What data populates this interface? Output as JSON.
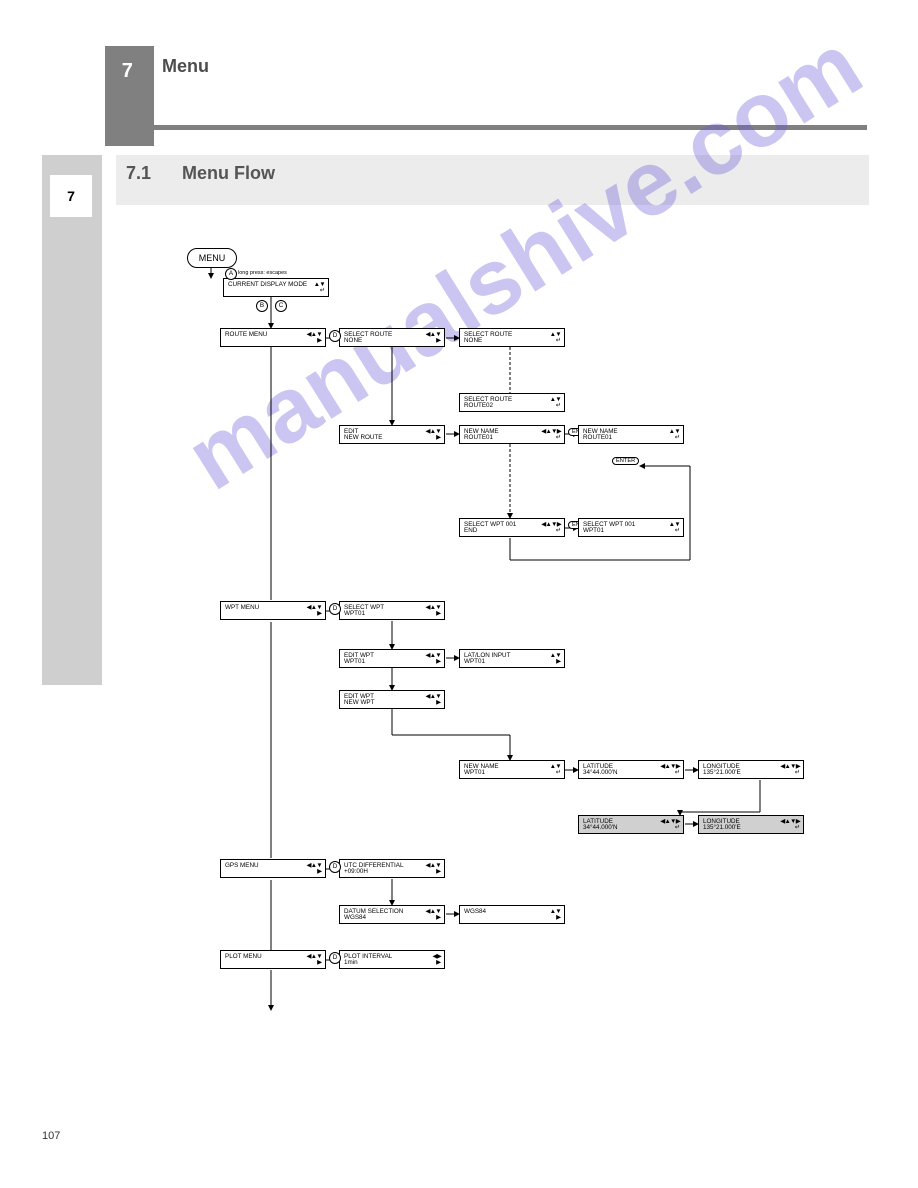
{
  "chapter_tab": "7",
  "chapter_title": "Menu",
  "side_num": "7",
  "section_num": "7.1",
  "section_title": "Menu Flow",
  "page_number": "107",
  "watermark": "manualshive.com",
  "menu_btn": "MENU",
  "tips": {
    "esc": "long press: escapes",
    "esc_short": "escapes"
  },
  "box": {
    "b1": {
      "l1": "CURRENT DISPLAY MODE",
      "l2": ""
    },
    "b2": {
      "l1": "ROUTE MENU",
      "l2": ""
    },
    "b3": {
      "l1": "SELECT ROUTE",
      "l2": "NONE"
    },
    "b4": {
      "l1": "SELECT ROUTE",
      "l2": "NONE"
    },
    "b4b": {
      "l1": "SELECT ROUTE",
      "l2": "ROUTE02"
    },
    "b5": {
      "l1": "EDIT",
      "l2": "NEW ROUTE"
    },
    "b6": {
      "l1": "NEW NAME",
      "l2": "ROUTE01"
    },
    "b7": {
      "l1": "NEW NAME",
      "l2": "ROUTE01"
    },
    "b8": {
      "l1": "SELECT WPT 001",
      "l2": "END"
    },
    "b9": {
      "l1": "SELECT WPT 001",
      "l2": "WPT01"
    },
    "b10": {
      "l1": "WPT MENU",
      "l2": ""
    },
    "b11": {
      "l1": "SELECT WPT",
      "l2": "WPT01"
    },
    "b12": {
      "l1": "EDIT WPT",
      "l2": "WPT01"
    },
    "b13": {
      "l1": "LAT/LON INPUT",
      "l2": "WPT01"
    },
    "b14": {
      "l1": "EDIT WPT",
      "l2": "NEW WPT"
    },
    "b15": {
      "l1": "NEW NAME",
      "l2": "WPT01"
    },
    "b16": {
      "l1": "LATITUDE",
      "l2": "34°44.000'N"
    },
    "b17": {
      "l1": "LONGITUDE",
      "l2": "135°21.000'E"
    },
    "b18": {
      "l1": "LATITUDE",
      "l2": "34°44.000'N"
    },
    "b19": {
      "l1": "LONGITUDE",
      "l2": "135°21.000'E"
    },
    "b20": {
      "l1": "GPS MENU",
      "l2": ""
    },
    "b21": {
      "l1": "UTC DIFFERENTIAL",
      "l2": "+09:00H"
    },
    "b22": {
      "l1": "DATUM SELECTION",
      "l2": "WGS84"
    },
    "b23": {
      "l1": "WGS84",
      "l2": ""
    },
    "b24": {
      "l1": "PLOT MENU",
      "l2": ""
    },
    "b25": {
      "l1": "PLOT INTERVAL",
      "l2": "1min"
    }
  },
  "icons": {
    "ud": "◀▲▼",
    "ud2": "▲▼",
    "ent": "↵",
    "rt": "▶",
    "lr": "◀▶",
    "lrud": "◀▲▼▶"
  },
  "pill_enter": "ENTER"
}
